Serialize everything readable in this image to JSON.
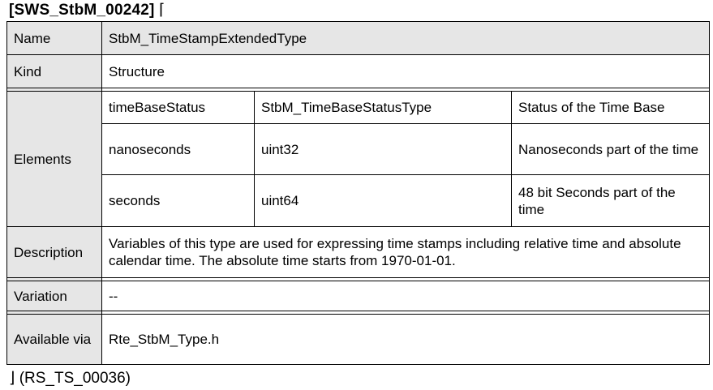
{
  "requirement": {
    "id": "[SWS_StbM_00242]",
    "open_bracket": "⌈",
    "close_bracket": "⌋",
    "trace": "(RS_TS_00036)"
  },
  "table": {
    "name": {
      "label": "Name",
      "value": "StbM_TimeStampExtendedType"
    },
    "kind": {
      "label": "Kind",
      "value": "Structure"
    },
    "elements": {
      "label": "Elements",
      "rows": [
        {
          "name": "timeBaseStatus",
          "type": "StbM_TimeBaseStatusType",
          "description": "Status of the Time Base"
        },
        {
          "name": "nanoseconds",
          "type": "uint32",
          "description": "Nanoseconds part of the time"
        },
        {
          "name": "seconds",
          "type": "uint64",
          "description": "48 bit Seconds part of the time"
        }
      ]
    },
    "description": {
      "label": "Description",
      "value": "Variables of this type are used for expressing time stamps including relative time and absolute calendar time. The absolute time starts from 1970-01-01."
    },
    "variation": {
      "label": "Variation",
      "value": "--"
    },
    "available_via": {
      "label": "Available via",
      "value": "Rte_StbM_Type.h"
    }
  }
}
